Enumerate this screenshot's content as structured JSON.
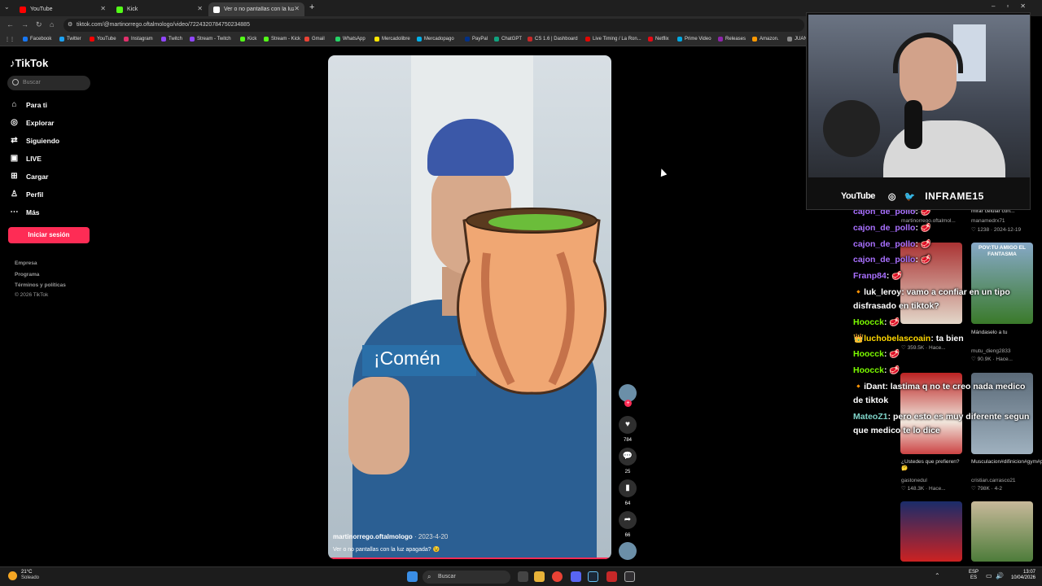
{
  "browser": {
    "tabs": [
      {
        "label": "YouTube",
        "color": "#ff0000"
      },
      {
        "label": "Kick",
        "color": "#53fc18"
      },
      {
        "label": "Ver o no pantallas con la luz ap...",
        "color": "#ffffff"
      }
    ],
    "url": "tiktok.com/@martinorrego.oftalmologo/video/7224320784750234885",
    "bookmarks": [
      "Facebook",
      "Twitter",
      "YouTube",
      "Instagram",
      "Twitch",
      "Stream - Twitch",
      "Kick",
      "Stream - Kick",
      "Gmail",
      "WhatsApp",
      "Mercadolibre",
      "Mercadopago",
      "PayPal",
      "ChatGPT",
      "CS 1.6 | Dashboard",
      "Live Timing / La Ron...",
      "Netflix",
      "Prime Video",
      "Releases",
      "Amazon.",
      "JUAN"
    ]
  },
  "tiktok": {
    "logo": "TikTok",
    "search_placeholder": "Buscar",
    "nav": [
      "Para ti",
      "Explorar",
      "Siguiendo",
      "LIVE",
      "Cargar",
      "Perfil",
      "Más"
    ],
    "login": "Iniciar sesión",
    "footer": [
      "Empresa",
      "Programa",
      "Términos y políticas",
      "© 2026 TikTok"
    ]
  },
  "video": {
    "overlay_text": "¡Comén",
    "username": "martinorrego.oftalmologo",
    "date": "· 2023-4-20",
    "description": "Ver o no pantallas con la luz apagada? 😉",
    "likes": "784",
    "comments": "25",
    "saves": "64",
    "shares": "66"
  },
  "stream": {
    "brand1": "YouTube",
    "brand2": "INFRAME15"
  },
  "feed": [
    {
      "title": "mirar celular con...",
      "user": "manamedrx71",
      "meta": "♡ 1238 · 2024-12-19"
    },
    {
      "overlay": "POV:TU AMIGO EL FANTASMA",
      "title": "Mándaselo a tu",
      "user": "mutu_dieng2833",
      "meta": "♡ 90.9K · Hace..."
    },
    {
      "title": "",
      "user": "",
      "meta": "♡ 359.5K · Hace..."
    },
    {
      "title": "¿Ustedes que prefieren? 🤔",
      "user": "gastonedul",
      "meta": "♡ 148.3K · Hace..."
    },
    {
      "title": "Musculacion#difinicion#gym#piern...",
      "user": "cristian.carrasco21",
      "meta": "♡ 798K · 4-2"
    },
    {
      "title": "...urno...",
      "user": "martinorrego.oftalmol...",
      "meta": ""
    }
  ],
  "chat": [
    {
      "user": "cajon_de_pollo",
      "color": "#a970ff",
      "msg": ": 🥩"
    },
    {
      "user": "cajon_de_pollo",
      "color": "#a970ff",
      "msg": ": 🥩"
    },
    {
      "user": "cajon_de_pollo",
      "color": "#a970ff",
      "msg": ": 🥩"
    },
    {
      "user": "cajon_de_pollo",
      "color": "#a970ff",
      "msg": ": 🥩"
    },
    {
      "user": "Franp84",
      "color": "#a970ff",
      "msg": ": 🥩"
    },
    {
      "user": "luk_leroy",
      "color": "#ffffff",
      "msg": ": vamo a confiar en un tipo disfrasado en tiktok?"
    },
    {
      "user": "Hoocck",
      "color": "#7cfc00",
      "msg": ": 🥩"
    },
    {
      "user": "luchobelascoain",
      "color": "#ffd700",
      "msg": ": ta bien"
    },
    {
      "user": "Hoocck",
      "color": "#7cfc00",
      "msg": ": 🥩"
    },
    {
      "user": "Hoocck",
      "color": "#7cfc00",
      "msg": ": 🥩"
    },
    {
      "user": "iDant",
      "color": "#ffffff",
      "msg": ": lastima q no te creo nada medico de tiktok"
    },
    {
      "user": "MateoZ1",
      "color": "#7fd4c9",
      "msg": ": pero esto es muy diferente segun que medico te lo dice"
    }
  ],
  "taskbar": {
    "weather_temp": "21°C",
    "weather_desc": "Soleado",
    "search": "Buscar",
    "lang1": "ESP",
    "lang2": "ES",
    "time": "13:07",
    "date": "10/04/2026"
  }
}
